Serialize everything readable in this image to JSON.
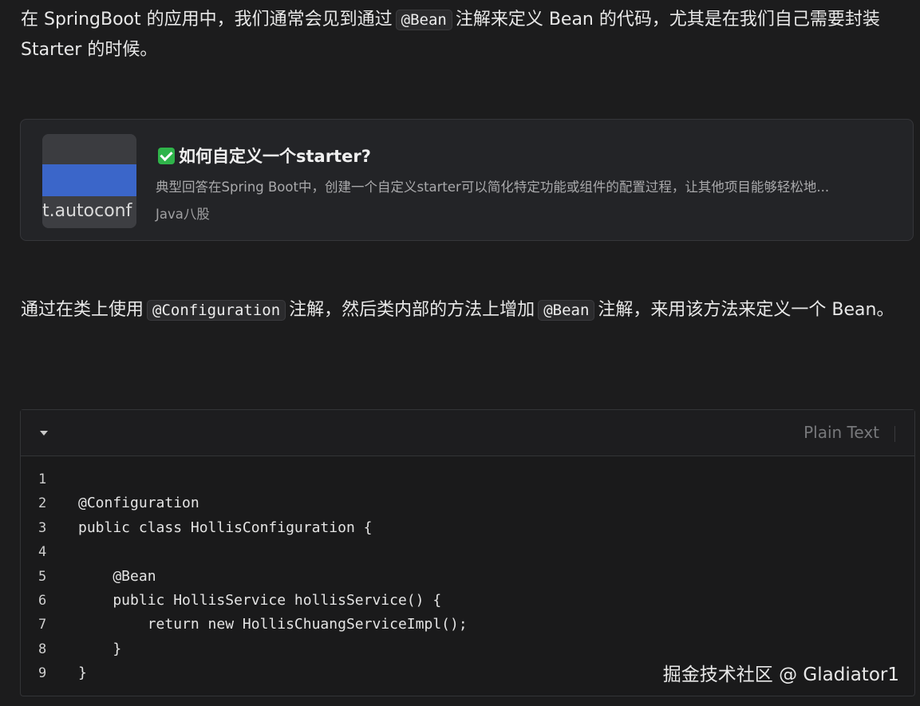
{
  "paragraph1": {
    "before": "在 SpringBoot 的应用中，我们通常会见到通过",
    "code": "@Bean",
    "after": "注解来定义 Bean 的代码，尤其是在我们自己需要封装 Starter 的时候。"
  },
  "card": {
    "thumb_text": "t.autoconf",
    "title": "如何自定义一个starter?",
    "description": "典型回答在Spring Boot中，创建一个自定义starter可以简化特定功能或组件的配置过程，让其他项目能够轻松地...",
    "source": "Java八股"
  },
  "paragraph2": {
    "before": "通过在类上使用",
    "code1": "@Configuration",
    "middle": "注解，然后类内部的方法上增加",
    "code2": "@Bean",
    "after": "注解，来用该方法来定义一个 Bean。"
  },
  "code_block": {
    "language": "Plain Text",
    "lines": [
      {
        "n": "1",
        "text": ""
      },
      {
        "n": "2",
        "text": "@Configuration"
      },
      {
        "n": "3",
        "text": "public class HollisConfiguration {"
      },
      {
        "n": "4",
        "text": ""
      },
      {
        "n": "5",
        "text": "    @Bean"
      },
      {
        "n": "6",
        "text": "    public HollisService hollisService() {"
      },
      {
        "n": "7",
        "text": "        return new HollisChuangServiceImpl();"
      },
      {
        "n": "8",
        "text": "    }"
      },
      {
        "n": "9",
        "text": "}"
      }
    ]
  },
  "watermark": "掘金技术社区 @ Gladiator1",
  "colors": {
    "background": "#1c1c1d",
    "check": "#2fb44a",
    "thumb_band": "#3b66c9"
  }
}
